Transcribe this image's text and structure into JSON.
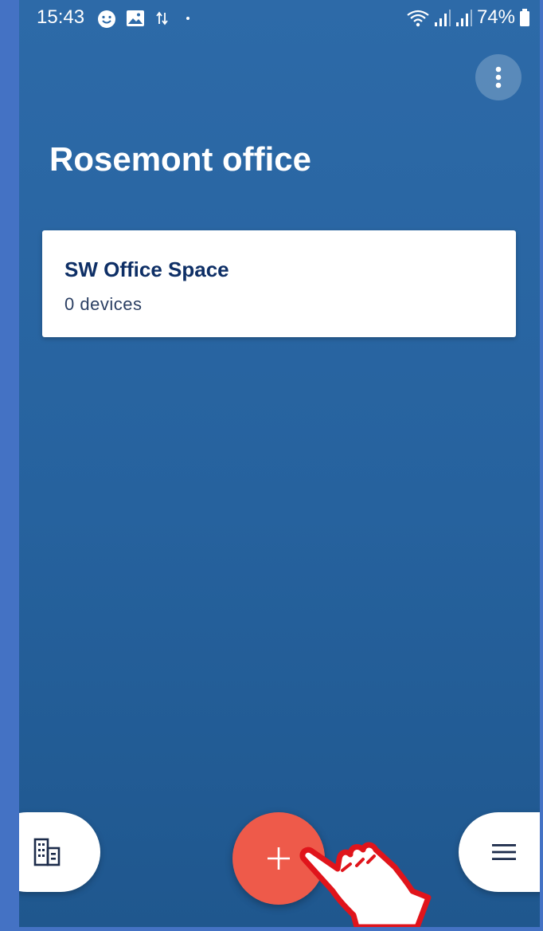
{
  "status_bar": {
    "time": "15:43",
    "battery": "74%",
    "left_icons": [
      "smiley-icon",
      "gallery-icon",
      "data-transfer-icon",
      "dot-icon"
    ],
    "right_icons": [
      "wifi-icon",
      "signal-icon",
      "signal-icon",
      "battery-icon"
    ]
  },
  "header": {
    "more_icon": "more-vertical-icon",
    "title": "Rosemont office"
  },
  "rooms": [
    {
      "name": "SW Office Space",
      "devices": "0 devices"
    }
  ],
  "bottom_bar": {
    "left_icon": "buildings-icon",
    "center_icon": "plus-icon",
    "right_icon": "menu-icon"
  },
  "colors": {
    "background": "#2d6aa8",
    "card": "#ffffff",
    "room_title": "#0e2f66",
    "fab": "#ee5a4a",
    "page_frame": "#4472c4"
  }
}
